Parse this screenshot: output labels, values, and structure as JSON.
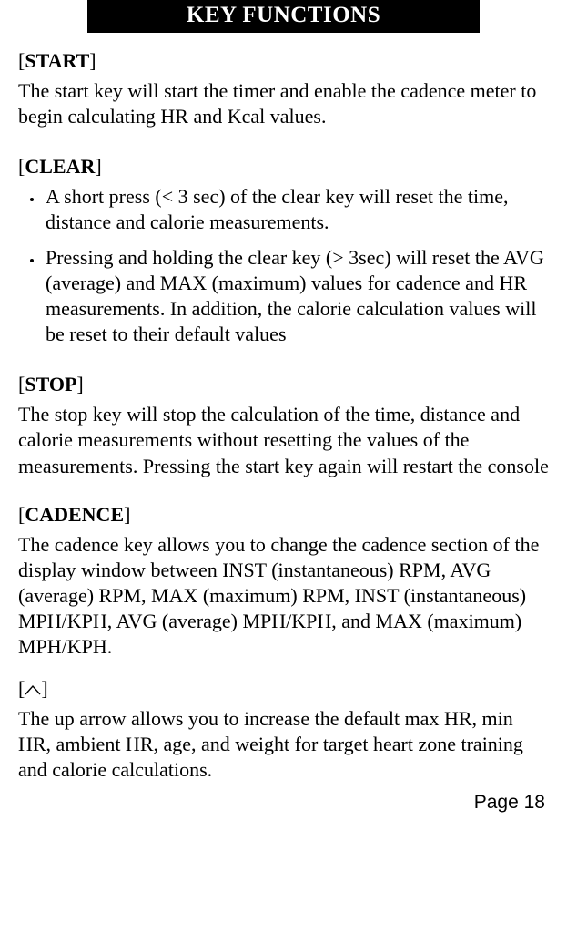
{
  "banner": "KEY FUNCTIONS",
  "sections": {
    "start": {
      "label": "START",
      "text": "The start key will start the timer and enable the cadence me­ter to begin calculating HR and Kcal values."
    },
    "clear": {
      "label": "CLEAR",
      "bullets": [
        "A short press (< 3 sec) of the clear key will reset the time, distance and calorie measurements.",
        "Pressing and holding the clear key (> 3sec) will reset the AVG (average) and MAX (maximum) values for cadence and HR measurements.  In addition, the calorie calcula­tion values will be reset to their default values"
      ]
    },
    "stop": {
      "label": "STOP",
      "text": "The stop key will stop the calculation of the time, distance and calorie measurements without resetting the values of the measurements. Pressing the start key again will restart the console"
    },
    "cadence": {
      "label": "CADENCE",
      "text": "The cadence key allows you to change the cadence section of the display window between INST (instantaneous) RPM, AVG (average) RPM, MAX (maximum) RPM, INST (instan­taneous) MPH/KPH, AVG (average) MPH/KPH, and MAX (maximum) MPH/KPH."
    },
    "up": {
      "text": "The up arrow allows you to increase the default max HR, min HR, ambient HR, age, and weight for target heart zone training and calorie calculations."
    }
  },
  "page_number": "Page 18"
}
